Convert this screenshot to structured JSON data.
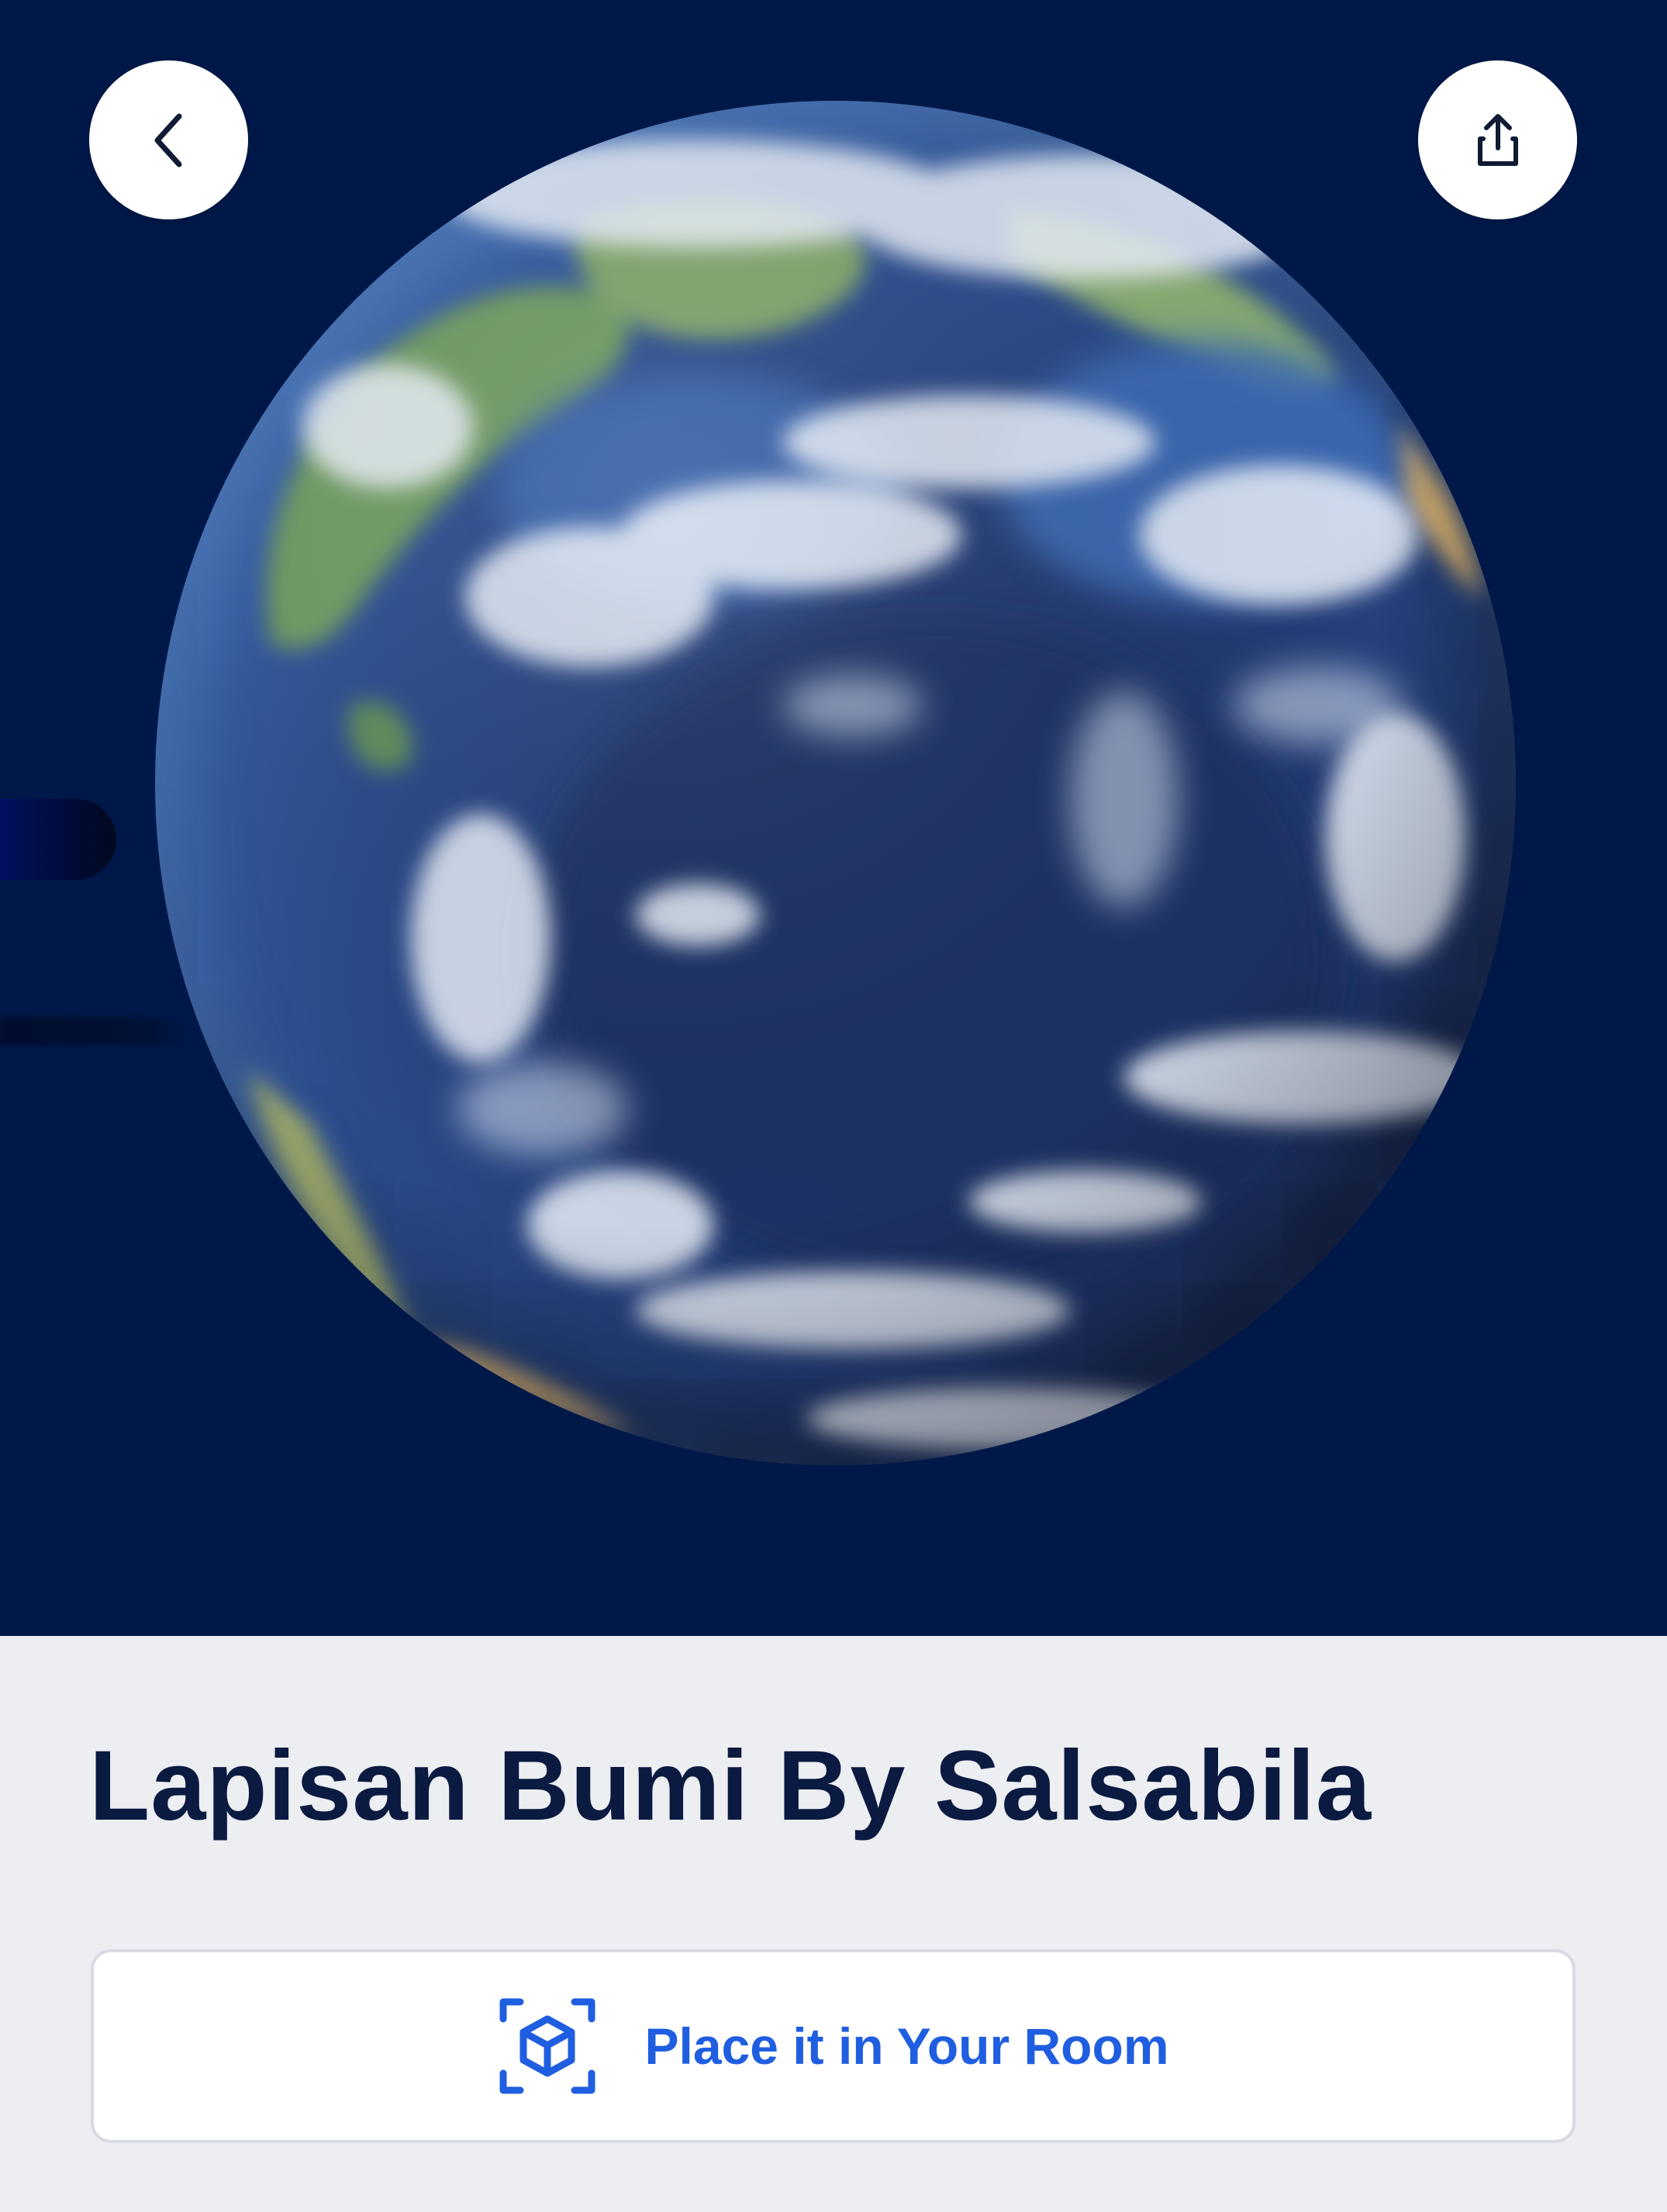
{
  "app": {
    "accent_color": "#1f5ee0",
    "viewer_background": "#001848"
  },
  "header": {
    "back_icon": "chevron-left-icon",
    "share_icon": "share-upload-icon"
  },
  "model": {
    "title": "Lapisan Bumi By Salsabila",
    "subject": "earth-globe-3d-model"
  },
  "actions": {
    "place_label": "Place it in Your Room",
    "place_icon": "ar-cube-icon"
  }
}
